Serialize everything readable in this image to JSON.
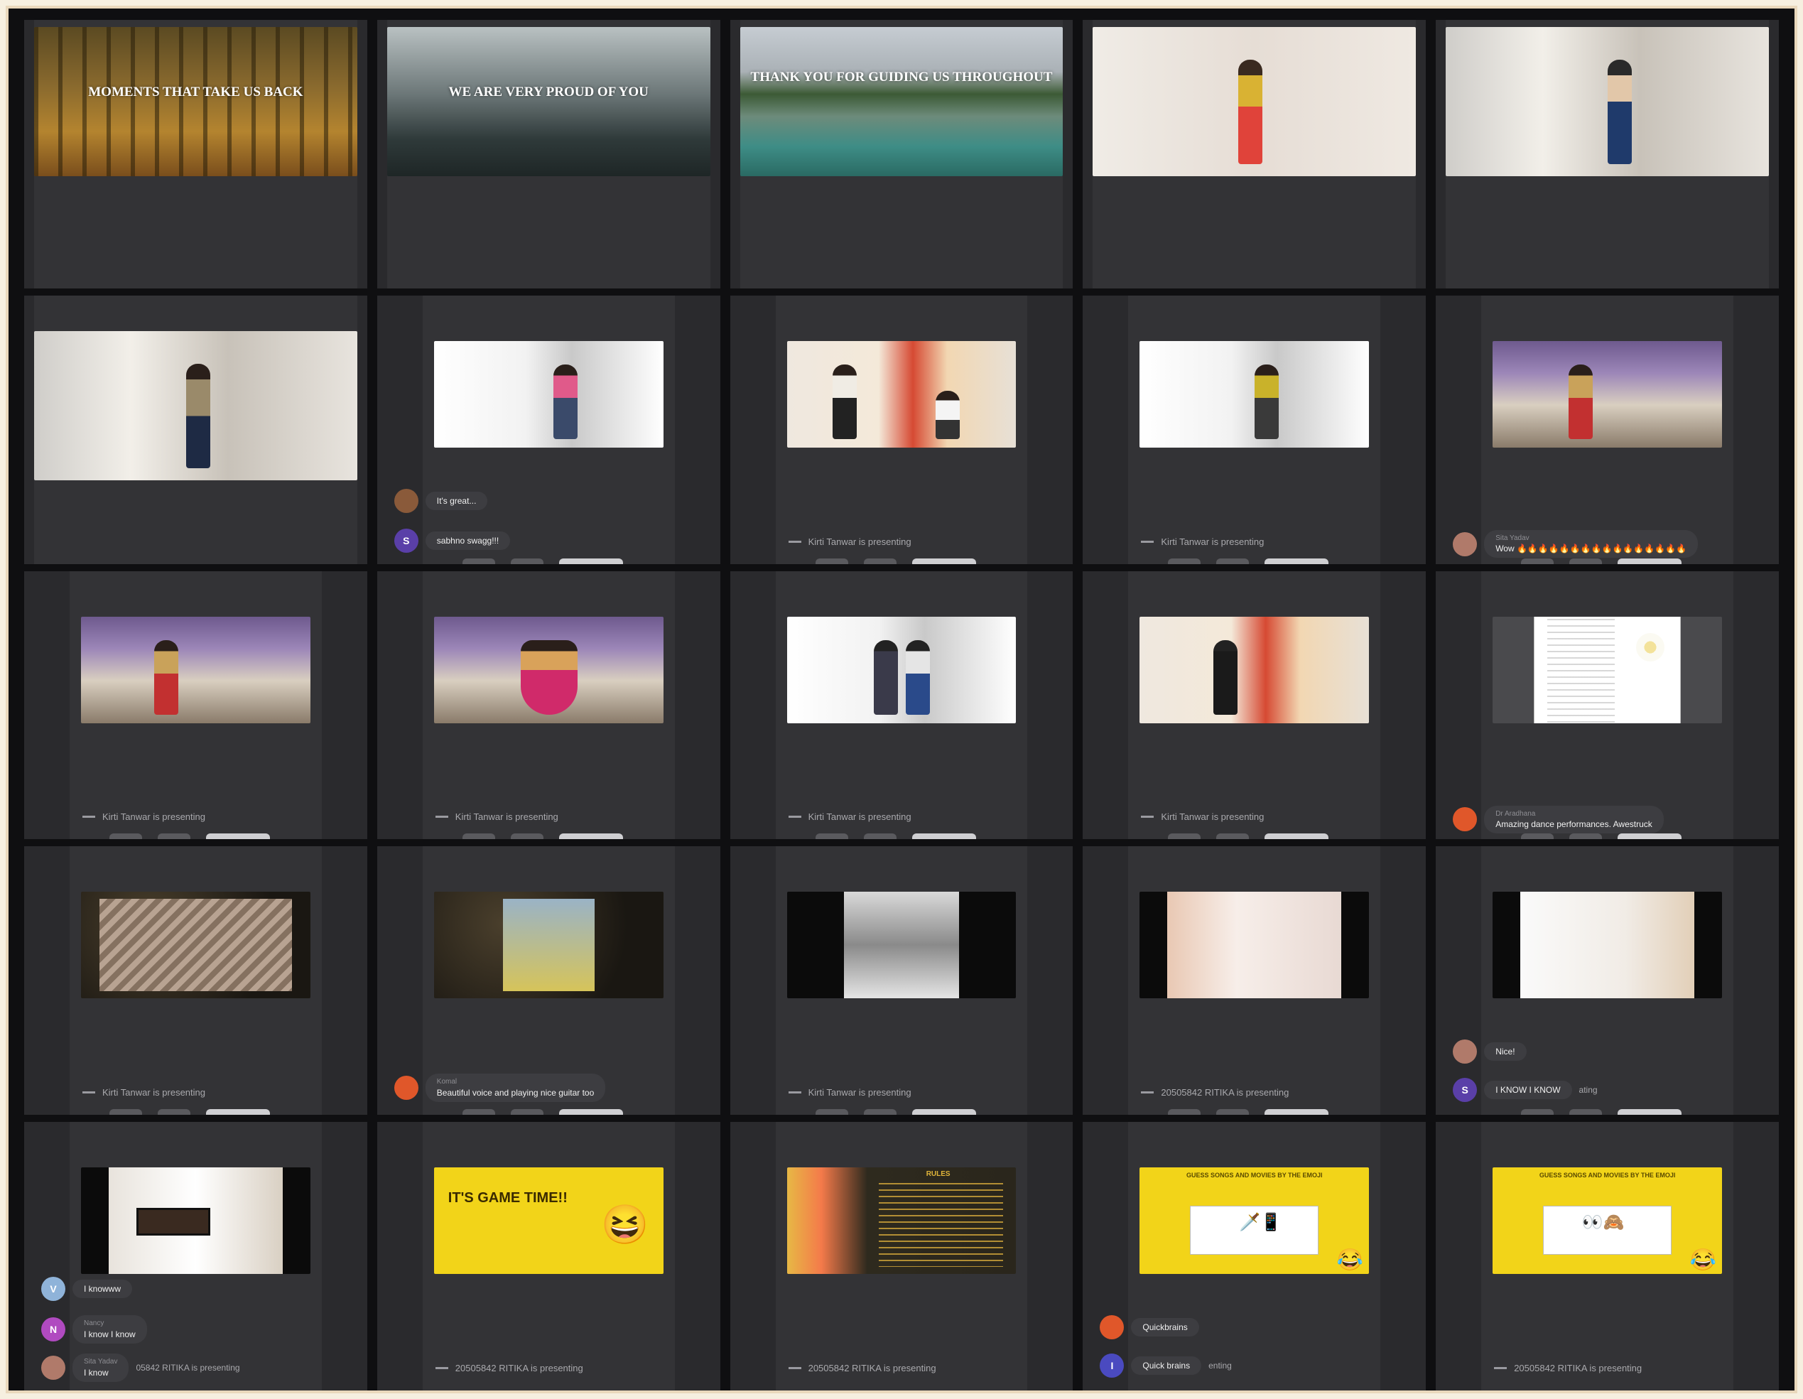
{
  "tiles": [
    {
      "row": 1,
      "col": 1,
      "title": "MOMENTS THAT TAKE US BACK"
    },
    {
      "row": 1,
      "col": 2,
      "title": "WE ARE VERY PROUD OF YOU"
    },
    {
      "row": 1,
      "col": 3,
      "title": "THANK YOU FOR GUIDING US THROUGHOUT"
    },
    {
      "row": 1,
      "col": 4
    },
    {
      "row": 1,
      "col": 5
    },
    {
      "row": 2,
      "col": 1
    },
    {
      "row": 2,
      "col": 2
    },
    {
      "row": 2,
      "col": 3,
      "status": "Kirti Tanwar is presenting"
    },
    {
      "row": 2,
      "col": 4,
      "status": "Kirti Tanwar is presenting"
    },
    {
      "row": 2,
      "col": 5
    },
    {
      "row": 3,
      "col": 1,
      "status": "Kirti Tanwar is presenting"
    },
    {
      "row": 3,
      "col": 2,
      "status": "Kirti Tanwar is presenting"
    },
    {
      "row": 3,
      "col": 3,
      "status": "Kirti Tanwar is presenting"
    },
    {
      "row": 3,
      "col": 4,
      "status": "Kirti Tanwar is presenting"
    },
    {
      "row": 3,
      "col": 5
    },
    {
      "row": 4,
      "col": 1,
      "status": "Kirti Tanwar is presenting"
    },
    {
      "row": 4,
      "col": 2
    },
    {
      "row": 4,
      "col": 3,
      "status": "Kirti Tanwar is presenting"
    },
    {
      "row": 4,
      "col": 4,
      "status": "20505842 RITIKA is presenting"
    },
    {
      "row": 4,
      "col": 5
    },
    {
      "row": 5,
      "col": 1
    },
    {
      "row": 5,
      "col": 2,
      "status": "20505842 RITIKA is presenting"
    },
    {
      "row": 5,
      "col": 3,
      "status": "20505842 RITIKA is presenting"
    },
    {
      "row": 5,
      "col": 4
    },
    {
      "row": 5,
      "col": 5,
      "status": "20505842 RITIKA is presenting"
    }
  ],
  "r2c2": {
    "c1_msg": "It's great...",
    "c2_msg": "sabhno swagg!!!"
  },
  "r2c5": {
    "c1_name": "Sita Yadav",
    "c1_msg": "Wow"
  },
  "r3c5": {
    "c1_name": "Dr Aradhana",
    "c1_msg": "Amazing dance performances. Awestruck"
  },
  "r4c2": {
    "c1_name": "Komal",
    "c1_msg": "Beautiful voice and playing nice guitar too"
  },
  "r4c5": {
    "c1_msg": "Nice!",
    "c2_msg": "I KNOW I KNOW",
    "c2_tail": "ating"
  },
  "r5c1": {
    "c1_msg": "I knowww",
    "c2_name": "Nancy",
    "c2_msg": "I know I know",
    "c3_name": "Sita Yadav",
    "c3_msg": "I know",
    "c3_tail": "05842 RITIKA is presenting"
  },
  "r5c2": {
    "title": "IT'S GAME TIME!!"
  },
  "r5c3": {
    "title": "RULES"
  },
  "r5c4": {
    "head": "GUESS SONGS AND MOVIES BY THE EMOJI",
    "c1_msg": "Quickbrains",
    "c2_msg": "Quick brains",
    "c2_tail": "enting"
  },
  "r5c5": {
    "head": "GUESS SONGS AND MOVIES BY THE EMOJI"
  }
}
